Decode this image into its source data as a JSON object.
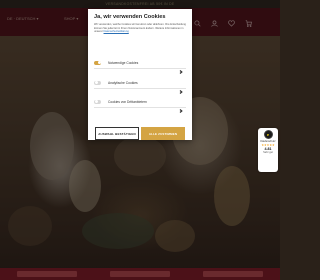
{
  "promo": {
    "text": "VERSANDKOSTENFREI AB 50€ IN DE"
  },
  "header": {
    "lang_label": "DE · DEUTSCH ▾",
    "nav_label": "SHOP ▾",
    "icons": [
      "search-icon",
      "user-icon",
      "heart-icon",
      "cart-icon"
    ]
  },
  "cookie_modal": {
    "title": "Ja, wir verwenden Cookies",
    "body": "Wir verwenden, welche Cookies wir benutzen oder ablehnen. Ihre Entscheidung können Sie jederzeit in Ihrem Nutzeraccount ändern. Weitere Informationen in unserer",
    "privacy_link": "Datenschutzerklärung",
    "options": [
      {
        "label": "Notwendige Cookies",
        "enabled": true
      },
      {
        "label": "Analytische Cookies",
        "enabled": false
      },
      {
        "label": "Cookies von Drittanbietern",
        "enabled": false
      }
    ],
    "btn_select": "AUSWAHL BESTÄTIGEN",
    "btn_accept": "ALLE ZUSTIMMEN"
  },
  "trust_badge": {
    "label": "Käuferschutz",
    "stars": "★★★★★",
    "score": "4.81",
    "desc": "Sehr gut"
  },
  "colors": {
    "accent": "#d4a443",
    "header": "#4c1118",
    "modal_bg": "#ffffff"
  }
}
